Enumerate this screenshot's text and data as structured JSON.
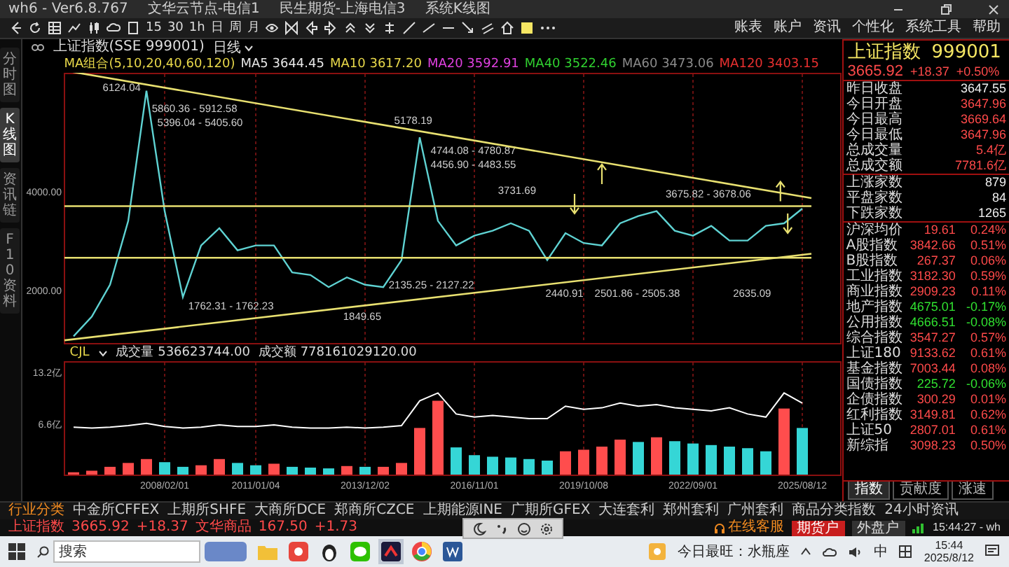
{
  "window": {
    "title_items": [
      "wh6 - Ver6.8.767",
      "文华云节点-电信1",
      "民生期货-上海电信3",
      "系统K线图"
    ]
  },
  "toolbar": {
    "periods": [
      "15",
      "30",
      "1h",
      "日",
      "周",
      "月"
    ],
    "menu": [
      "账表",
      "账户",
      "资讯",
      "个性化",
      "系统工具",
      "帮助"
    ]
  },
  "side_tabs": [
    {
      "label": "分时图",
      "selected": false
    },
    {
      "label": "K线图",
      "selected": true
    },
    {
      "label": "资讯链",
      "selected": false
    },
    {
      "label": "F10资料",
      "selected": false
    }
  ],
  "chart": {
    "title": "上证指数(SSE 999001)",
    "period": "日线",
    "indicators": [
      {
        "label": "MA组合(5,10,20,40,60,120)",
        "color": "#e8d84a"
      },
      {
        "label": "MA5 3644.45",
        "color": "#e6e6e6"
      },
      {
        "label": "MA10 3617.20",
        "color": "#e8d84a"
      },
      {
        "label": "MA20 3592.91",
        "color": "#e040e0"
      },
      {
        "label": "MA40 3522.46",
        "color": "#30d030"
      },
      {
        "label": "MA60 3473.06",
        "color": "#8a8a8a"
      },
      {
        "label": "MA120 3403.15",
        "color": "#e83030"
      }
    ],
    "price_labels": [
      "6124.04",
      "5860.36 - 5912.58",
      "5178.19",
      "5396.04 - 5405.60",
      "4744.08 - 4780.87",
      "4456.90 - 4483.55",
      "3731.69",
      "3675.82 - 3678.06",
      "2440.91",
      "2501.86 - 2505.38",
      "2635.09",
      "2135.25 - 2127.22",
      "1762.31 - 1762.23",
      "1849.65"
    ],
    "chart_data": {
      "type": "line",
      "grid": true,
      "ylim": [
        900,
        6400
      ],
      "yticks": [
        {
          "value": 2000,
          "label": "2000.00"
        },
        {
          "value": 4000,
          "label": "4000.00"
        }
      ],
      "categories": [
        null,
        null,
        null,
        null,
        null,
        null,
        null,
        null,
        null,
        null,
        null,
        null,
        null,
        null,
        null,
        null,
        null,
        null,
        null,
        null,
        null,
        null,
        null,
        null,
        null,
        null,
        null,
        null,
        null,
        null,
        null,
        null,
        null,
        null,
        null,
        null,
        null,
        null,
        null,
        null,
        null
      ],
      "series": [
        {
          "color": "#5fd3d3",
          "values": [
            1050,
            1450,
            2100,
            3400,
            6050,
            3600,
            1850,
            2900,
            3250,
            2800,
            2900,
            2900,
            2350,
            2300,
            2050,
            2250,
            2100,
            2050,
            2600,
            5100,
            3400,
            2900,
            3100,
            3200,
            3350,
            3200,
            2600,
            3150,
            2950,
            2900,
            3350,
            3500,
            3600,
            3200,
            3100,
            3300,
            3000,
            3000,
            3300,
            3350,
            3650
          ]
        }
      ]
    },
    "volume": {
      "label": "CJL",
      "readings": [
        "成交量 536623744.00",
        "成交额 778161029120.00"
      ],
      "chart_data": {
        "type": "bar",
        "grid": true,
        "ylim": [
          0,
          14.5
        ],
        "yticks": [
          {
            "value": 6.6,
            "label": "6.6亿"
          },
          {
            "value": 13.2,
            "label": "13.2亿"
          }
        ],
        "categories": [
          null,
          null,
          null,
          null,
          null,
          "2008/02/01",
          null,
          null,
          null,
          null,
          "2011/01/04",
          null,
          null,
          null,
          null,
          null,
          "2013/12/02",
          null,
          null,
          null,
          null,
          null,
          "2016/11/01",
          null,
          null,
          null,
          null,
          null,
          "2019/10/08",
          null,
          null,
          null,
          null,
          null,
          "2022/09/01",
          null,
          null,
          null,
          null,
          null,
          "2025/08/12"
        ],
        "series": [
          {
            "color": "#ff4d4d",
            "values": [
              0.3,
              0.5,
              1.0,
              1.5,
              2.0,
              null,
              null,
              1.2,
              2.0,
              null,
              null,
              1.4,
              null,
              null,
              null,
              1.1,
              null,
              1.0,
              1.5,
              6.0,
              9.5,
              null,
              null,
              null,
              null,
              null,
              null,
              3.0,
              3.2,
              3.6,
              4.5,
              null,
              4.8,
              null,
              null,
              null,
              null,
              null,
              null,
              8.5,
              null
            ]
          },
          {
            "color": "#35d6d6",
            "values": [
              null,
              null,
              null,
              null,
              null,
              1.6,
              1.0,
              null,
              null,
              1.5,
              1.2,
              null,
              1.0,
              0.9,
              0.8,
              null,
              1.0,
              null,
              null,
              null,
              null,
              3.5,
              2.5,
              2.3,
              2.2,
              2.0,
              1.8,
              null,
              null,
              null,
              null,
              4.2,
              null,
              4.3,
              4.0,
              3.8,
              3.6,
              3.4,
              3.0,
              null,
              6.0
            ]
          },
          {
            "type": "line",
            "color": "#ffffff",
            "values": [
              6.1,
              6.0,
              6.1,
              6.3,
              6.6,
              6.2,
              6.0,
              6.1,
              6.4,
              6.2,
              6.2,
              6.4,
              6.1,
              6.0,
              6.0,
              6.1,
              6.0,
              6.1,
              6.3,
              9.5,
              10.5,
              7.8,
              7.4,
              7.6,
              7.4,
              7.2,
              7.2,
              8.8,
              8.4,
              8.6,
              9.2,
              8.8,
              9.0,
              8.6,
              8.4,
              8.2,
              8.6,
              7.8,
              7.4,
              10.5,
              9.2
            ]
          }
        ]
      }
    }
  },
  "quote_panel": {
    "name": "上证指数",
    "code": "999001",
    "price": "3665.92",
    "change": "+18.37",
    "percent": "+0.50%",
    "stats": [
      {
        "label": "昨日收盘",
        "value": "3647.55",
        "rising": false
      },
      {
        "label": "今日开盘",
        "value": "3647.96",
        "rising": true
      },
      {
        "label": "今日最高",
        "value": "3669.64",
        "rising": true
      },
      {
        "label": "今日最低",
        "value": "3647.96",
        "rising": true
      },
      {
        "label": "总成交量",
        "value": "5.4亿",
        "rising": true
      },
      {
        "label": "总成交额",
        "value": "7781.6亿",
        "rising": true
      }
    ],
    "breadth": [
      {
        "label": "上涨家数",
        "value": "879"
      },
      {
        "label": "平盘家数",
        "value": "84"
      },
      {
        "label": "下跌家数",
        "value": "1265"
      }
    ],
    "indices": [
      {
        "label": "沪深均价",
        "value": "19.61",
        "percent": "0.24%",
        "rising": true
      },
      {
        "label": "A股指数",
        "value": "3842.66",
        "percent": "0.51%",
        "rising": true
      },
      {
        "label": "B股指数",
        "value": "267.37",
        "percent": "0.06%",
        "rising": true
      },
      {
        "label": "工业指数",
        "value": "3182.30",
        "percent": "0.59%",
        "rising": true
      },
      {
        "label": "商业指数",
        "value": "2909.23",
        "percent": "0.11%",
        "rising": true
      },
      {
        "label": "地产指数",
        "value": "4675.01",
        "percent": "-0.17%",
        "rising": false
      },
      {
        "label": "公用指数",
        "value": "4666.51",
        "percent": "-0.08%",
        "rising": false
      },
      {
        "label": "综合指数",
        "value": "3547.27",
        "percent": "0.57%",
        "rising": true
      },
      {
        "label": "上证180",
        "value": "9133.62",
        "percent": "0.61%",
        "rising": true
      },
      {
        "label": "基金指数",
        "value": "7003.44",
        "percent": "0.08%",
        "rising": true
      },
      {
        "label": "国债指数",
        "value": "225.72",
        "percent": "-0.06%",
        "rising": false
      },
      {
        "label": "企债指数",
        "value": "300.29",
        "percent": "0.01%",
        "rising": true
      },
      {
        "label": "红利指数",
        "value": "3149.81",
        "percent": "0.62%",
        "rising": true
      },
      {
        "label": "上证50",
        "value": "2807.01",
        "percent": "0.61%",
        "rising": true
      },
      {
        "label": "新综指",
        "value": "3098.23",
        "percent": "0.50%",
        "rising": true
      }
    ],
    "tabs": [
      {
        "label": "指数",
        "selected": true
      },
      {
        "label": "贡献度",
        "selected": false
      },
      {
        "label": "涨速",
        "selected": false
      }
    ]
  },
  "market_tabs": [
    {
      "label": "行业分类",
      "selected": true
    },
    {
      "label": "中金所CFFEX",
      "selected": false
    },
    {
      "label": "上期所SHFE",
      "selected": false
    },
    {
      "label": "大商所DCE",
      "selected": false
    },
    {
      "label": "郑商所CZCE",
      "selected": false
    },
    {
      "label": "上期能源INE",
      "selected": false
    },
    {
      "label": "广期所GFEX",
      "selected": false
    },
    {
      "label": "大连套利",
      "selected": false
    },
    {
      "label": "郑州套利",
      "selected": false
    },
    {
      "label": "广州套利",
      "selected": false
    },
    {
      "label": "商品分类指数",
      "selected": false
    },
    {
      "label": "24小时资讯",
      "selected": false
    }
  ],
  "service": "在线客服",
  "ticker": [
    {
      "name": "上证指数",
      "value": "3665.92",
      "change": "+18.37"
    },
    {
      "name": "文华商品",
      "value": "167.50",
      "change": "+1.73"
    }
  ],
  "account_buttons": [
    {
      "label": "期货户",
      "selected": true
    },
    {
      "label": "外盘户",
      "selected": false
    }
  ],
  "clock": "15:44:27 - wh",
  "taskbar": {
    "search_placeholder": "搜索",
    "notice": "今日最旺：水瓶座",
    "ime": "中",
    "time": "15:44",
    "date": "2025/8/12"
  }
}
